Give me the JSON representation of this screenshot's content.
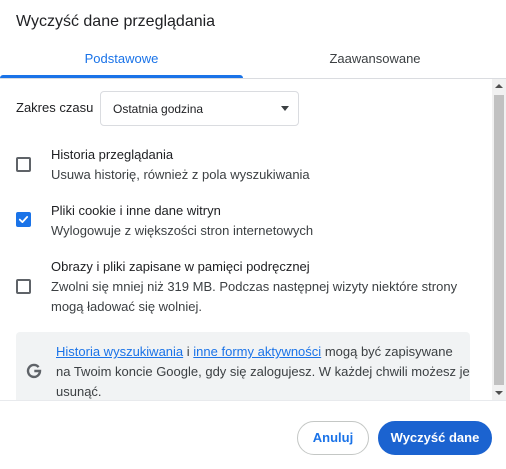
{
  "dialog": {
    "title": "Wyczyść dane przeglądania"
  },
  "tabs": [
    {
      "label": "Podstawowe",
      "active": true
    },
    {
      "label": "Zaawansowane",
      "active": false
    }
  ],
  "time_range": {
    "label": "Zakres czasu",
    "selected": "Ostatnia godzina",
    "icon": "caret-down-icon"
  },
  "options": [
    {
      "title": "Historia przeglądania",
      "description_lines": [
        "Usuwa historię, również z pola wyszukiwania"
      ],
      "checked": false
    },
    {
      "title": "Pliki cookie i inne dane witryn",
      "description_lines": [
        "Wylogowuje z większości stron internetowych"
      ],
      "checked": true
    },
    {
      "title": "Obrazy i pliki zapisane w pamięci podręcznej",
      "description_lines": [
        "Zwolni się mniej niż 319 MB. Podczas następnej wizyty niektóre strony",
        "mogą ładować się wolniej."
      ],
      "checked": false
    }
  ],
  "google_notice": {
    "icon": "google-g-icon",
    "link_search_history": "Historia wyszukiwania",
    "connector": "i",
    "link_other_activity": "inne formy aktywności",
    "line1_rest": "mogą być zapisywane",
    "line2": "na Twoim koncie Google, gdy się zalogujesz. W każdej chwili możesz je",
    "line3": "usunąć."
  },
  "footer": {
    "cancel_label": "Anuluj",
    "confirm_label": "Wyczyść dane"
  },
  "icons": {
    "checkbox_check": "checkmark-icon",
    "scroll_up": "scroll-up-arrow-icon",
    "scroll_down": "scroll-down-arrow-icon"
  },
  "colors": {
    "accent": "#1a73e8",
    "primary_button": "#1b63d0",
    "text": "#202124",
    "secondary_text": "#5f6368",
    "notice_background": "#f1f3f4"
  }
}
